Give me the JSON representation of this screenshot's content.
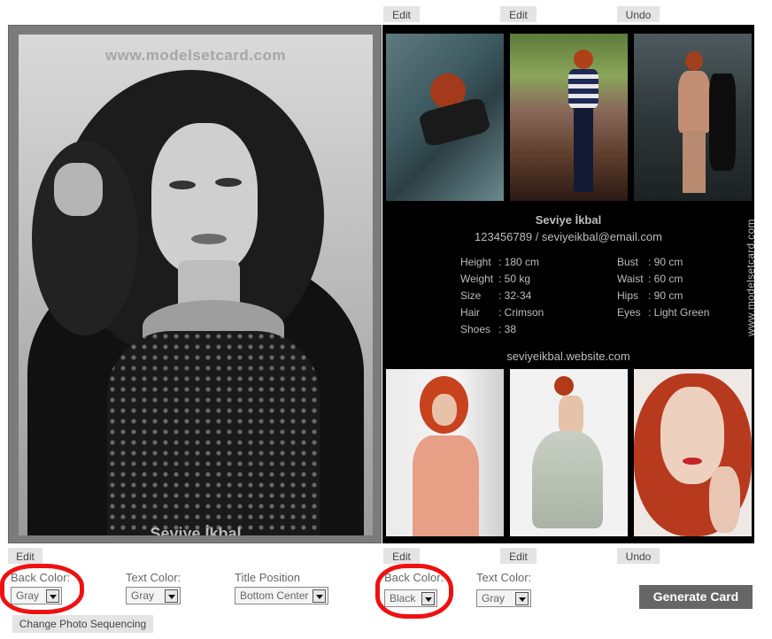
{
  "top_buttons": {
    "edit_left": "Edit",
    "edit_right": "Edit",
    "undo": "Undo"
  },
  "bottom_buttons": {
    "edit_left_card": "Edit",
    "edit_a": "Edit",
    "edit_b": "Edit",
    "undo": "Undo"
  },
  "left_card": {
    "watermark": "www.modelsetcard.com",
    "name": "Seviye İkbal"
  },
  "right_card": {
    "name": "Seviye İkbal",
    "contact": "123456789 / seviyeikbal@email.com",
    "stats_left": [
      {
        "label": "Height",
        "value": ": 180 cm"
      },
      {
        "label": "Weight",
        "value": ": 50 kg"
      },
      {
        "label": "Size",
        "value": ": 32-34"
      },
      {
        "label": "Hair",
        "value": ": Crimson"
      },
      {
        "label": "Shoes",
        "value": ": 38"
      }
    ],
    "stats_right": [
      {
        "label": "Bust",
        "value": ": 90 cm"
      },
      {
        "label": "Waist",
        "value": ": 60 cm"
      },
      {
        "label": "Hips",
        "value": ": 90 cm"
      },
      {
        "label": "Eyes",
        "value": ": Light Green"
      }
    ],
    "website": "seviyeikbal.website.com",
    "watermark": "www.modelsetcard.com"
  },
  "controls": {
    "left_back_color": {
      "label": "Back Color:",
      "value": "Gray"
    },
    "left_text_color": {
      "label": "Text Color:",
      "value": "Gray"
    },
    "title_position": {
      "label": "Title Position",
      "value": "Bottom Center"
    },
    "right_back_color": {
      "label": "Back Color:",
      "value": "Black"
    },
    "right_text_color": {
      "label": "Text Color:",
      "value": "Gray"
    },
    "generate": "Generate Card",
    "sequence": "Change Photo Sequencing"
  },
  "colors": {
    "highlight_ring": "#ee1111",
    "generate_bg": "#666666",
    "right_card_bg": "#000000",
    "left_card_bg": "#7b7b7b"
  }
}
